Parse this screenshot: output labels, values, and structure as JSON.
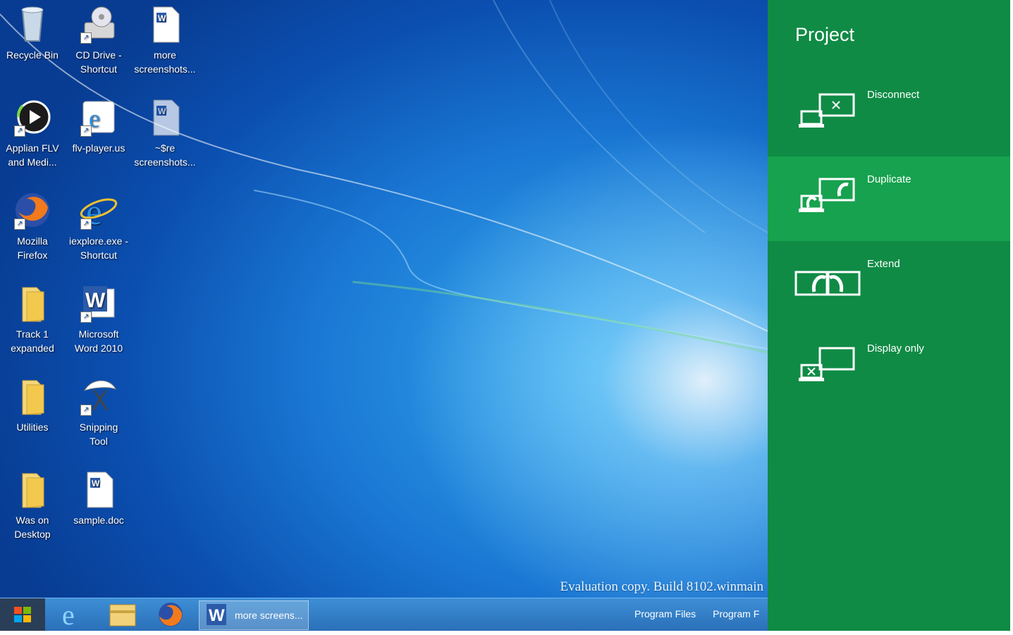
{
  "desktop": {
    "watermark": "Evaluation copy. Build 8102.winmain",
    "icons": [
      {
        "name": "recycle-bin",
        "line1": "Recycle Bin",
        "line2": ""
      },
      {
        "name": "cd-drive",
        "line1": "CD Drive -",
        "line2": "Shortcut"
      },
      {
        "name": "more-screenshots",
        "line1": "more",
        "line2": "screenshots..."
      },
      {
        "name": "applian-flv",
        "line1": "Applian FLV",
        "line2": "and Medi..."
      },
      {
        "name": "flv-player",
        "line1": "flv-player.us",
        "line2": ""
      },
      {
        "name": "sre-screenshots",
        "line1": "~$re",
        "line2": "screenshots..."
      },
      {
        "name": "mozilla-firefox",
        "line1": "Mozilla",
        "line2": "Firefox"
      },
      {
        "name": "iexplore-shortcut",
        "line1": "iexplore.exe -",
        "line2": "Shortcut"
      },
      {
        "name": "track-1-expanded",
        "line1": "Track 1",
        "line2": "expanded"
      },
      {
        "name": "word-2010",
        "line1": "Microsoft",
        "line2": "Word 2010"
      },
      {
        "name": "utilities",
        "line1": "Utilities",
        "line2": ""
      },
      {
        "name": "snipping-tool",
        "line1": "Snipping",
        "line2": "Tool"
      },
      {
        "name": "was-on-desktop",
        "line1": "Was on",
        "line2": "Desktop"
      },
      {
        "name": "sample-doc",
        "line1": "sample.doc",
        "line2": ""
      }
    ]
  },
  "taskbar": {
    "word_window_label": "more screens...",
    "toolbar_links": [
      "Program Files",
      "Program F"
    ]
  },
  "project_pane": {
    "title": "Project",
    "options": [
      {
        "label": "Disconnect",
        "selected": false
      },
      {
        "label": "Duplicate",
        "selected": true
      },
      {
        "label": "Extend",
        "selected": false
      },
      {
        "label": "Display only",
        "selected": false
      }
    ]
  },
  "colors": {
    "charm_green": "#0f8b45",
    "charm_selected": "#17a24f",
    "taskbar_blue": "#2a6fb8"
  }
}
